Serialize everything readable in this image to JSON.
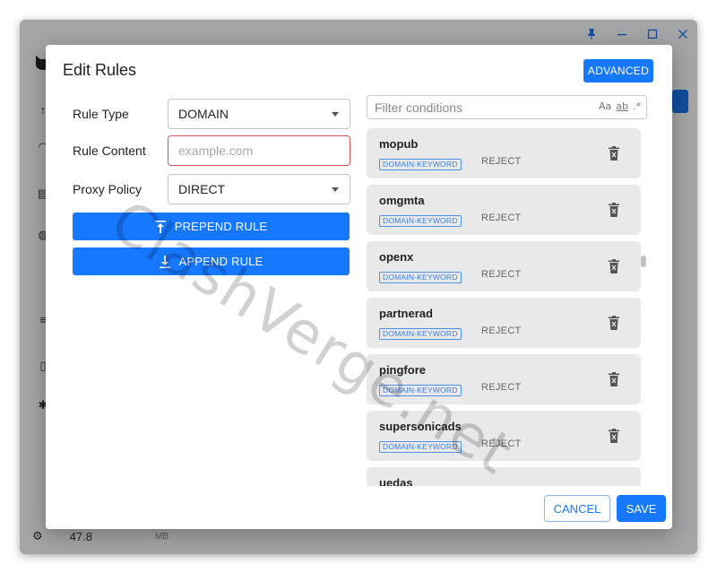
{
  "app": {
    "memory_value": "47.8",
    "memory_unit": "MB",
    "window_controls": [
      "pin-icon",
      "minimize-icon",
      "maximize-icon",
      "close-icon"
    ]
  },
  "dialog": {
    "title": "Edit Rules",
    "advanced_label": "ADVANCED",
    "form": {
      "rule_type_label": "Rule Type",
      "rule_type_value": "DOMAIN",
      "rule_content_label": "Rule Content",
      "rule_content_placeholder": "example.com",
      "proxy_policy_label": "Proxy Policy",
      "proxy_policy_value": "DIRECT"
    },
    "prepend_label": "PREPEND RULE",
    "append_label": "APPEND RULE",
    "filter": {
      "placeholder": "Filter conditions",
      "match_case": "Aa",
      "match_word": "ab",
      "regex": ".*"
    },
    "rules": [
      {
        "name": "mopub",
        "type": "DOMAIN-KEYWORD",
        "proxy": "REJECT"
      },
      {
        "name": "omgmta",
        "type": "DOMAIN-KEYWORD",
        "proxy": "REJECT"
      },
      {
        "name": "openx",
        "type": "DOMAIN-KEYWORD",
        "proxy": "REJECT"
      },
      {
        "name": "partnerad",
        "type": "DOMAIN-KEYWORD",
        "proxy": "REJECT"
      },
      {
        "name": "pingfore",
        "type": "DOMAIN-KEYWORD",
        "proxy": "REJECT"
      },
      {
        "name": "supersonicads",
        "type": "DOMAIN-KEYWORD",
        "proxy": "REJECT"
      },
      {
        "name": "uedas",
        "type": "",
        "proxy": ""
      }
    ],
    "cancel_label": "CANCEL",
    "save_label": "SAVE"
  },
  "watermark": "ClashVerge.net",
  "colors": {
    "accent": "#1677ff",
    "error_border": "#e05050",
    "tag": "#3d7fe0"
  }
}
